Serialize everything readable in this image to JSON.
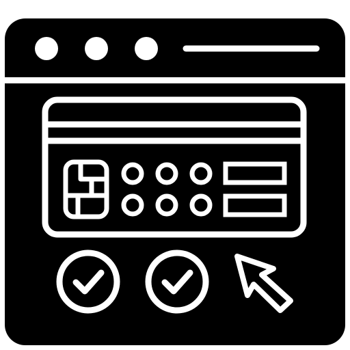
{
  "icon": {
    "subject": "online-card-payment-icon",
    "colors": {
      "foreground": "#000000",
      "background": "#ffffff"
    },
    "window": {
      "controls": [
        "dot-icon",
        "dot-icon",
        "dot-icon"
      ],
      "address_bar": "line-icon"
    },
    "card": {
      "chip": "chip-icon",
      "keypad_dots": 6,
      "fields": 2
    },
    "checks": [
      "check-circle-icon",
      "check-circle-icon"
    ],
    "pointer": "cursor-arrow-icon"
  }
}
